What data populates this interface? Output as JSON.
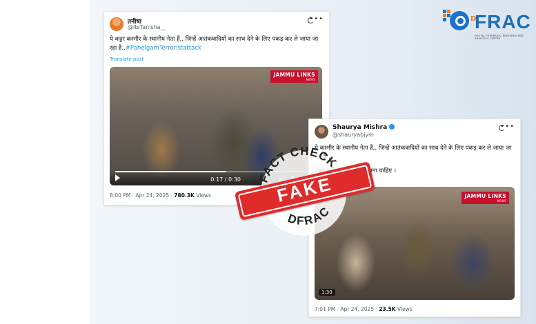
{
  "tweet1": {
    "author_name": "तनीषा",
    "author_handle": "@ItsTanisha__",
    "text_main": "ये कट्टर कश्मीर के स्थानीय नेता हैं,, जिन्हें आतंकवादियों का साथ देने के लिए पकड़ कर ले जाया जा रहा है..",
    "hashtag": "#PahelgamTerroristattack",
    "translate_label": "Translate post",
    "video_tag": "JAMMU LINKS",
    "video_tag_sub": "NEWS",
    "time_code": "0:17 / 0:30",
    "video_progress": 0.55,
    "timestamp": "8:00 PM · Apr 24, 2025 ·",
    "views_count": "780.3K",
    "views_label": "Views"
  },
  "tweet2": {
    "author_name": "Shaurya Mishra",
    "author_handle": "@shauryabjym",
    "text_main": "ये कश्मीर के स्थानीय नेता हैं,, जिन्हें आतंकवादियों का साथ देने के लिए पकड़ कर ले जाया जा रहा है..",
    "text_second": "उम्रकैद से भरा भर दिया जाना चाहिए ।",
    "video_tag": "JAMMU LINKS",
    "video_tag_sub": "NEWS",
    "duration": "1:30",
    "timestamp": "7:01 PM · Apr 24, 2025 ·",
    "views_count": "23.5K",
    "views_label": "Views"
  },
  "logo": {
    "text": "FRAC",
    "prefix": "D",
    "subtitle": "DIGITAL FORENSICS, RESEARCH AND ANALYTICS CENTRE"
  },
  "stamp": {
    "top_text": "FACT CHECK",
    "main_text": "FAKE",
    "bottom_text": "DFRAC",
    "color": "#e02b2b"
  },
  "colors": {
    "link": "#1d9bf0",
    "brand_blue": "#1a6fb5",
    "brand_orange": "#f07c22"
  }
}
